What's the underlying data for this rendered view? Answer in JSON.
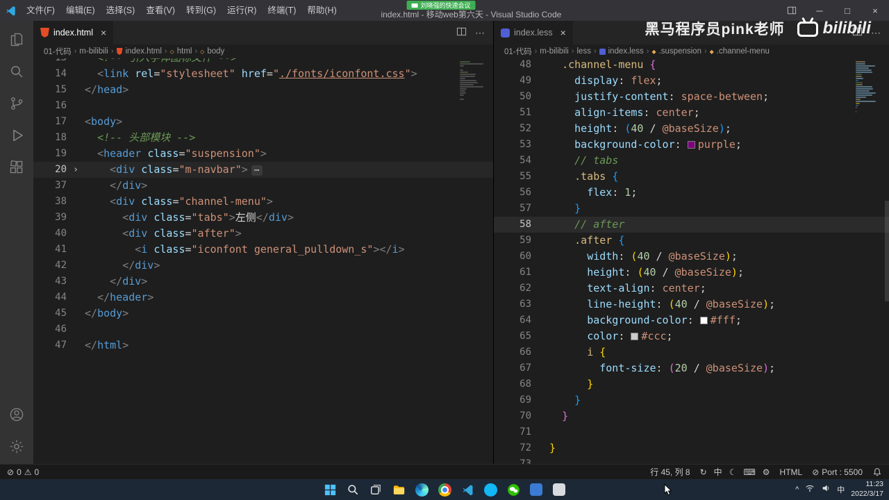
{
  "titlebar": {
    "menus": [
      "文件(F)",
      "编辑(E)",
      "选择(S)",
      "查看(V)",
      "转到(G)",
      "运行(R)",
      "终端(T)",
      "帮助(H)"
    ],
    "title": "index.html - 移动web第六天 - Visual Studio Code",
    "meeting_badge": "刘晓强的快速会议"
  },
  "watermark": {
    "text": "黑马程序员pink老师",
    "logo_text": "bilibili"
  },
  "activity_bar": {
    "top": [
      "explorer",
      "search",
      "source-control",
      "run-debug",
      "extensions"
    ],
    "bottom": [
      "account",
      "settings"
    ]
  },
  "left_editor": {
    "tab": {
      "label": "index.html"
    },
    "breadcrumb": [
      {
        "label": "01-代码"
      },
      {
        "label": "m-bilibili"
      },
      {
        "label": "index.html",
        "icon": "html-file"
      },
      {
        "label": "html",
        "icon": "symbol"
      },
      {
        "label": "body",
        "icon": "symbol"
      }
    ],
    "lines": [
      {
        "n": 13,
        "tokens": [
          [
            "d",
            "  "
          ],
          [
            "c",
            "<!-- 引入字体图标文件 -->"
          ]
        ]
      },
      {
        "n": 14,
        "tokens": [
          [
            "d",
            "  "
          ],
          [
            "p",
            "<"
          ],
          [
            "t",
            "link"
          ],
          [
            "d",
            " "
          ],
          [
            "a",
            "rel"
          ],
          [
            "d",
            "="
          ],
          [
            "s",
            "\"stylesheet\""
          ],
          [
            "d",
            " "
          ],
          [
            "a",
            "href"
          ],
          [
            "d",
            "="
          ],
          [
            "s",
            "\""
          ],
          [
            "u",
            "./fonts/iconfont.css"
          ],
          [
            "s",
            "\""
          ],
          [
            "p",
            ">"
          ]
        ]
      },
      {
        "n": 15,
        "tokens": [
          [
            "p",
            "</"
          ],
          [
            "t",
            "head"
          ],
          [
            "p",
            ">"
          ]
        ]
      },
      {
        "n": 16,
        "tokens": []
      },
      {
        "n": 17,
        "tokens": [
          [
            "p",
            "<"
          ],
          [
            "t",
            "body"
          ],
          [
            "p",
            ">"
          ]
        ]
      },
      {
        "n": 18,
        "tokens": [
          [
            "d",
            "  "
          ],
          [
            "c",
            "<!-- 头部模块 -->"
          ]
        ]
      },
      {
        "n": 19,
        "tokens": [
          [
            "d",
            "  "
          ],
          [
            "p",
            "<"
          ],
          [
            "t",
            "header"
          ],
          [
            "d",
            " "
          ],
          [
            "a",
            "class"
          ],
          [
            "d",
            "="
          ],
          [
            "s",
            "\"suspension\""
          ],
          [
            "p",
            ">"
          ]
        ]
      },
      {
        "n": 20,
        "fold": true,
        "highlight": true,
        "tokens": [
          [
            "d",
            "    "
          ],
          [
            "p",
            "<"
          ],
          [
            "t",
            "div"
          ],
          [
            "d",
            " "
          ],
          [
            "a",
            "class"
          ],
          [
            "d",
            "="
          ],
          [
            "s",
            "\"m-navbar\""
          ],
          [
            "p",
            ">"
          ],
          [
            "fold",
            "⋯"
          ]
        ]
      },
      {
        "n": 37,
        "tokens": [
          [
            "d",
            "    "
          ],
          [
            "p",
            "</"
          ],
          [
            "t",
            "div"
          ],
          [
            "p",
            ">"
          ]
        ]
      },
      {
        "n": 38,
        "tokens": [
          [
            "d",
            "    "
          ],
          [
            "p",
            "<"
          ],
          [
            "t",
            "div"
          ],
          [
            "d",
            " "
          ],
          [
            "a",
            "class"
          ],
          [
            "d",
            "="
          ],
          [
            "s",
            "\"channel-menu\""
          ],
          [
            "p",
            ">"
          ]
        ]
      },
      {
        "n": 39,
        "tokens": [
          [
            "d",
            "      "
          ],
          [
            "p",
            "<"
          ],
          [
            "t",
            "div"
          ],
          [
            "d",
            " "
          ],
          [
            "a",
            "class"
          ],
          [
            "d",
            "="
          ],
          [
            "s",
            "\"tabs\""
          ],
          [
            "p",
            ">"
          ],
          [
            "d",
            "左侧"
          ],
          [
            "p",
            "</"
          ],
          [
            "t",
            "div"
          ],
          [
            "p",
            ">"
          ]
        ]
      },
      {
        "n": 40,
        "tokens": [
          [
            "d",
            "      "
          ],
          [
            "p",
            "<"
          ],
          [
            "t",
            "div"
          ],
          [
            "d",
            " "
          ],
          [
            "a",
            "class"
          ],
          [
            "d",
            "="
          ],
          [
            "s",
            "\"after\""
          ],
          [
            "p",
            ">"
          ]
        ]
      },
      {
        "n": 41,
        "tokens": [
          [
            "d",
            "        "
          ],
          [
            "p",
            "<"
          ],
          [
            "t",
            "i"
          ],
          [
            "d",
            " "
          ],
          [
            "a",
            "class"
          ],
          [
            "d",
            "="
          ],
          [
            "s",
            "\"iconfont general_pulldown_s\""
          ],
          [
            "p",
            ">"
          ],
          [
            "p",
            "</"
          ],
          [
            "t",
            "i"
          ],
          [
            "p",
            ">"
          ]
        ]
      },
      {
        "n": 42,
        "tokens": [
          [
            "d",
            "      "
          ],
          [
            "p",
            "</"
          ],
          [
            "t",
            "div"
          ],
          [
            "p",
            ">"
          ]
        ]
      },
      {
        "n": 43,
        "tokens": [
          [
            "d",
            "    "
          ],
          [
            "p",
            "</"
          ],
          [
            "t",
            "div"
          ],
          [
            "p",
            ">"
          ]
        ]
      },
      {
        "n": 44,
        "tokens": [
          [
            "d",
            "  "
          ],
          [
            "p",
            "</"
          ],
          [
            "t",
            "header"
          ],
          [
            "p",
            ">"
          ]
        ]
      },
      {
        "n": 45,
        "tokens": [
          [
            "p",
            "</"
          ],
          [
            "t",
            "body"
          ],
          [
            "p",
            ">"
          ]
        ]
      },
      {
        "n": 46,
        "tokens": []
      },
      {
        "n": 47,
        "tokens": [
          [
            "p",
            "</"
          ],
          [
            "t",
            "html"
          ],
          [
            "p",
            ">"
          ]
        ]
      }
    ]
  },
  "right_editor": {
    "tab": {
      "label": "index.less"
    },
    "breadcrumb": [
      {
        "label": "01-代码"
      },
      {
        "label": "m-bilibili"
      },
      {
        "label": "less"
      },
      {
        "label": "index.less",
        "icon": "less-file"
      },
      {
        "label": ".suspension",
        "icon": "class-symbol"
      },
      {
        "label": ".channel-menu",
        "icon": "class-symbol"
      }
    ],
    "lines": [
      {
        "n": 48,
        "tokens": [
          [
            "d",
            "  "
          ],
          [
            "sel",
            ".channel-menu"
          ],
          [
            "d",
            " "
          ],
          [
            "b2",
            "{"
          ]
        ]
      },
      {
        "n": 49,
        "tokens": [
          [
            "d",
            "    "
          ],
          [
            "prop",
            "display"
          ],
          [
            "d",
            ": "
          ],
          [
            "val",
            "flex"
          ],
          [
            "d",
            ";"
          ]
        ]
      },
      {
        "n": 50,
        "tokens": [
          [
            "d",
            "    "
          ],
          [
            "prop",
            "justify-content"
          ],
          [
            "d",
            ": "
          ],
          [
            "val",
            "space-between"
          ],
          [
            "d",
            ";"
          ]
        ]
      },
      {
        "n": 51,
        "tokens": [
          [
            "d",
            "    "
          ],
          [
            "prop",
            "align-items"
          ],
          [
            "d",
            ": "
          ],
          [
            "val",
            "center"
          ],
          [
            "d",
            ";"
          ]
        ]
      },
      {
        "n": 52,
        "tokens": [
          [
            "d",
            "    "
          ],
          [
            "prop",
            "height"
          ],
          [
            "d",
            ": "
          ],
          [
            "b3",
            "("
          ],
          [
            "num",
            "40"
          ],
          [
            "d",
            " / "
          ],
          [
            "var",
            "@baseSize"
          ],
          [
            "b3",
            ")"
          ],
          [
            "d",
            ";"
          ]
        ]
      },
      {
        "n": 53,
        "tokens": [
          [
            "d",
            "    "
          ],
          [
            "prop",
            "background-color"
          ],
          [
            "d",
            ": "
          ],
          [
            "sw",
            "#800080"
          ],
          [
            "val",
            "purple"
          ],
          [
            "d",
            ";"
          ]
        ]
      },
      {
        "n": 54,
        "tokens": [
          [
            "d",
            "    "
          ],
          [
            "c",
            "// tabs"
          ]
        ]
      },
      {
        "n": 55,
        "tokens": [
          [
            "d",
            "    "
          ],
          [
            "sel",
            ".tabs"
          ],
          [
            "d",
            " "
          ],
          [
            "b3",
            "{"
          ]
        ]
      },
      {
        "n": 56,
        "tokens": [
          [
            "d",
            "      "
          ],
          [
            "prop",
            "flex"
          ],
          [
            "d",
            ": "
          ],
          [
            "num",
            "1"
          ],
          [
            "d",
            ";"
          ]
        ]
      },
      {
        "n": 57,
        "tokens": [
          [
            "d",
            "    "
          ],
          [
            "b3",
            "}"
          ]
        ]
      },
      {
        "n": 58,
        "current": true,
        "tokens": [
          [
            "d",
            "    "
          ],
          [
            "c",
            "// after"
          ]
        ]
      },
      {
        "n": 59,
        "tokens": [
          [
            "d",
            "    "
          ],
          [
            "sel",
            ".after"
          ],
          [
            "d",
            " "
          ],
          [
            "b3",
            "{"
          ]
        ]
      },
      {
        "n": 60,
        "tokens": [
          [
            "d",
            "      "
          ],
          [
            "prop",
            "width"
          ],
          [
            "d",
            ": "
          ],
          [
            "b1",
            "("
          ],
          [
            "num",
            "40"
          ],
          [
            "d",
            " / "
          ],
          [
            "var",
            "@baseSize"
          ],
          [
            "b1",
            ")"
          ],
          [
            "d",
            ";"
          ]
        ]
      },
      {
        "n": 61,
        "tokens": [
          [
            "d",
            "      "
          ],
          [
            "prop",
            "height"
          ],
          [
            "d",
            ": "
          ],
          [
            "b1",
            "("
          ],
          [
            "num",
            "40"
          ],
          [
            "d",
            " / "
          ],
          [
            "var",
            "@baseSize"
          ],
          [
            "b1",
            ")"
          ],
          [
            "d",
            ";"
          ]
        ]
      },
      {
        "n": 62,
        "tokens": [
          [
            "d",
            "      "
          ],
          [
            "prop",
            "text-align"
          ],
          [
            "d",
            ": "
          ],
          [
            "val",
            "center"
          ],
          [
            "d",
            ";"
          ]
        ]
      },
      {
        "n": 63,
        "tokens": [
          [
            "d",
            "      "
          ],
          [
            "prop",
            "line-height"
          ],
          [
            "d",
            ": "
          ],
          [
            "b1",
            "("
          ],
          [
            "num",
            "40"
          ],
          [
            "d",
            " / "
          ],
          [
            "var",
            "@baseSize"
          ],
          [
            "b1",
            ")"
          ],
          [
            "d",
            ";"
          ]
        ]
      },
      {
        "n": 64,
        "tokens": [
          [
            "d",
            "      "
          ],
          [
            "prop",
            "background-color"
          ],
          [
            "d",
            ": "
          ],
          [
            "sw",
            "#ffffff"
          ],
          [
            "val",
            "#fff"
          ],
          [
            "d",
            ";"
          ]
        ]
      },
      {
        "n": 65,
        "tokens": [
          [
            "d",
            "      "
          ],
          [
            "prop",
            "color"
          ],
          [
            "d",
            ": "
          ],
          [
            "sw",
            "#cccccc"
          ],
          [
            "val",
            "#ccc"
          ],
          [
            "d",
            ";"
          ]
        ]
      },
      {
        "n": 66,
        "tokens": [
          [
            "d",
            "      "
          ],
          [
            "sel",
            "i"
          ],
          [
            "d",
            " "
          ],
          [
            "b1",
            "{"
          ]
        ]
      },
      {
        "n": 67,
        "tokens": [
          [
            "d",
            "        "
          ],
          [
            "prop",
            "font-size"
          ],
          [
            "d",
            ": "
          ],
          [
            "b2",
            "("
          ],
          [
            "num",
            "20"
          ],
          [
            "d",
            " / "
          ],
          [
            "var",
            "@baseSize"
          ],
          [
            "b2",
            ")"
          ],
          [
            "d",
            ";"
          ]
        ]
      },
      {
        "n": 68,
        "tokens": [
          [
            "d",
            "      "
          ],
          [
            "b1",
            "}"
          ]
        ]
      },
      {
        "n": 69,
        "tokens": [
          [
            "d",
            "    "
          ],
          [
            "b3",
            "}"
          ]
        ]
      },
      {
        "n": 70,
        "tokens": [
          [
            "d",
            "  "
          ],
          [
            "b2",
            "}"
          ]
        ]
      },
      {
        "n": 71,
        "tokens": []
      },
      {
        "n": 72,
        "tokens": [
          [
            "b1",
            "}"
          ]
        ]
      },
      {
        "n": 73,
        "tokens": []
      }
    ]
  },
  "status_bar": {
    "errors": "0",
    "warnings": "0",
    "cursor": "行 45, 列 8",
    "icons": [
      "sync",
      "ime-chinese",
      "moon",
      "keyboard",
      "settings"
    ],
    "language": "HTML",
    "port": "Port : 5500"
  },
  "taskbar": {
    "icons": [
      "start",
      "search",
      "task-view",
      "file-explorer",
      "edge",
      "chrome",
      "vscode",
      "qq",
      "wechat",
      "app-blue",
      "app-gray"
    ],
    "tray": {
      "ime": "中",
      "time": "11:23",
      "date": "2022/3/17"
    }
  }
}
